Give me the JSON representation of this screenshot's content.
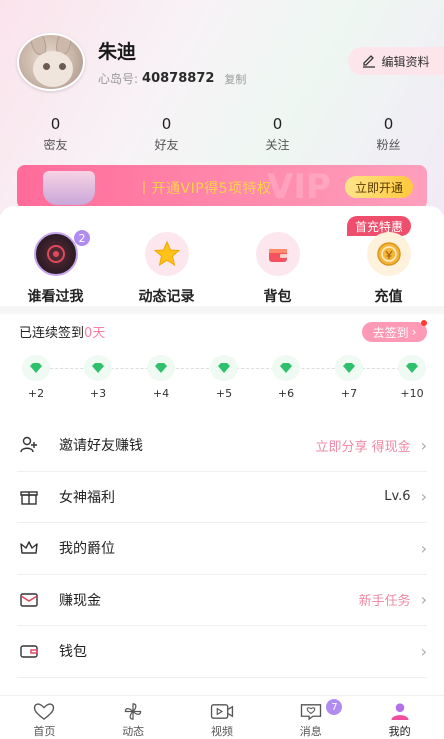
{
  "profile": {
    "nickname": "朱迪",
    "id_label": "心岛号:",
    "id_value": "40878872",
    "copy_label": "复制",
    "edit_label": "编辑资料"
  },
  "stats": [
    {
      "value": "0",
      "label": "密友"
    },
    {
      "value": "0",
      "label": "好友"
    },
    {
      "value": "0",
      "label": "关注"
    },
    {
      "value": "0",
      "label": "粉丝"
    }
  ],
  "vip_banner": {
    "text": "丨开通VIP得5项特权",
    "button": "立即开通"
  },
  "quick_actions": [
    {
      "label": "谁看过我",
      "badge": "2"
    },
    {
      "label": "动态记录"
    },
    {
      "label": "背包"
    },
    {
      "label": "充值"
    }
  ],
  "first_recharge_tag": "首充特惠",
  "signin": {
    "prefix": "已连续签到",
    "days": "0天",
    "button": "去签到",
    "steps": [
      "+2",
      "+3",
      "+4",
      "+5",
      "+6",
      "+7",
      "+10"
    ]
  },
  "menu": [
    {
      "label": "邀请好友赚钱",
      "value": "立即分享 得现金",
      "icon": "user-plus-icon"
    },
    {
      "label": "女神福利",
      "value": "Lv.6",
      "icon": "gift-icon"
    },
    {
      "label": "我的爵位",
      "value": "",
      "icon": "crown-icon"
    },
    {
      "label": "赚现金",
      "value": "新手任务",
      "icon": "envelope-icon"
    },
    {
      "label": "钱包",
      "value": "",
      "icon": "wallet-icon"
    }
  ],
  "tabbar": [
    {
      "label": "首页",
      "icon": "home-heart-icon"
    },
    {
      "label": "动态",
      "icon": "pinwheel-icon"
    },
    {
      "label": "视频",
      "icon": "video-icon"
    },
    {
      "label": "消息",
      "icon": "message-heart-icon",
      "badge": "7"
    },
    {
      "label": "我的",
      "icon": "profile-icon"
    }
  ],
  "colors": {
    "accent_pink": "#ff7fa2",
    "badge_purple": "#b18cf0",
    "gem_green": "#2fc06b"
  }
}
